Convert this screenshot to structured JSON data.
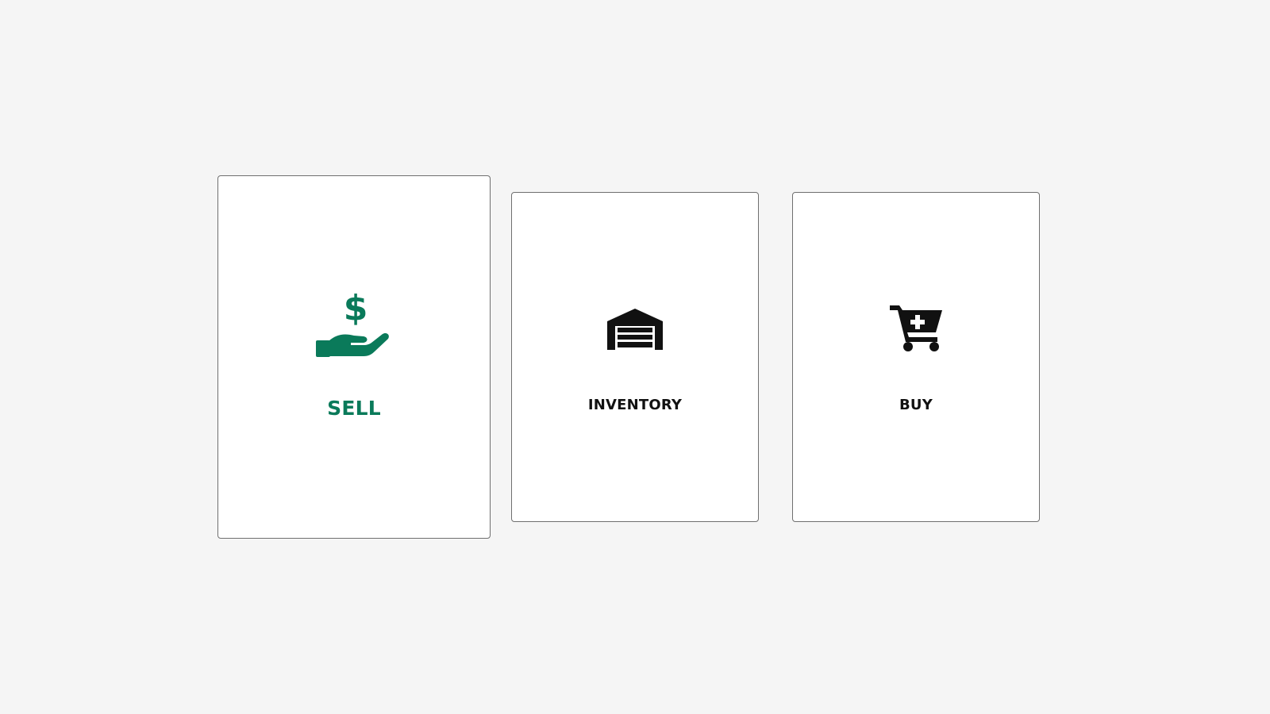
{
  "colors": {
    "page_background": "#f5f5f5",
    "card_background": "#ffffff",
    "card_border": "#6f6f6f",
    "accent": "#0a7a5a",
    "default_text": "#111111"
  },
  "cards": [
    {
      "label": "SELL",
      "icon": "hand-dollar-icon",
      "selected": true
    },
    {
      "label": "INVENTORY",
      "icon": "warehouse-icon",
      "selected": false
    },
    {
      "label": "BUY",
      "icon": "cart-plus-icon",
      "selected": false
    }
  ]
}
